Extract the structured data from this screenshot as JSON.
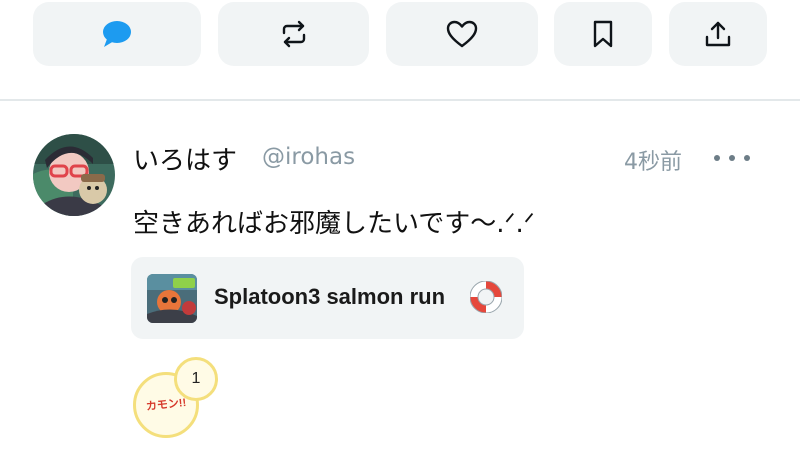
{
  "action_bar": {
    "buttons": [
      {
        "name": "reply",
        "icon": "chat-bubble-icon",
        "color": "#1d9bf0"
      },
      {
        "name": "repost",
        "icon": "repost-icon",
        "color": "#0f1419"
      },
      {
        "name": "like",
        "icon": "heart-icon",
        "color": "#0f1419"
      },
      {
        "name": "bookmark",
        "icon": "bookmark-icon",
        "color": "#0f1419"
      },
      {
        "name": "share",
        "icon": "share-upload-icon",
        "color": "#0f1419"
      }
    ]
  },
  "post": {
    "display_name": "いろはす",
    "handle": "@irohas",
    "timestamp": "4秒前",
    "more_icon": "more-horizontal-icon",
    "text": "空きあればお邪魔したいです〜.ᐟ.ᐟ",
    "channel": {
      "name": "Splatoon3 salmon run",
      "emoji_icon": "lifebuoy-icon"
    },
    "reaction": {
      "label": "カモン!!",
      "count": "1"
    }
  },
  "colors": {
    "button_bg": "#f1f4f5",
    "muted_text": "#8a9aa4",
    "divider": "#e3e8ea",
    "reaction_border": "#f4df7c"
  }
}
